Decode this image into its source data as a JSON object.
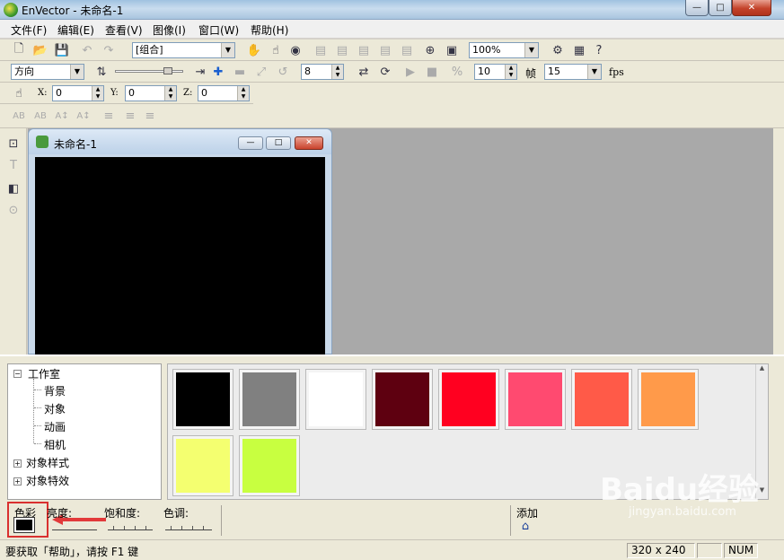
{
  "window": {
    "title": "EnVector - 未命名-1",
    "minimize": "—",
    "maximize": "□",
    "close": "✕"
  },
  "menu": [
    "文件(F)",
    "编辑(E)",
    "查看(V)",
    "图像(I)",
    "窗口(W)",
    "帮助(H)"
  ],
  "toolbar1": {
    "group_combo": "[组合]",
    "zoom_combo": "100%"
  },
  "toolbar2": {
    "direction_combo": "方向",
    "step_value": "8",
    "frames_value": "10",
    "frame_unit": "帧",
    "fps_value": "15",
    "fps_label": "fps"
  },
  "toolbar3": {
    "x_label": "X:",
    "x_value": "0",
    "y_label": "Y:",
    "y_value": "0",
    "z_label": "Z:",
    "z_value": "0"
  },
  "document": {
    "title": "未命名-1"
  },
  "tree": {
    "root": "工作室",
    "children": [
      "背景",
      "对象",
      "动画",
      "相机"
    ],
    "siblings": [
      "对象样式",
      "对象特效"
    ]
  },
  "swatches": [
    "#000000",
    "#808080",
    "#ffffff",
    "#5e0010",
    "#ff0020",
    "#ff4a70",
    "#ff5a48",
    "#ff9a4a",
    "#f4ff70",
    "#c8ff40"
  ],
  "color_controls": {
    "color_label": "色彩",
    "brightness_label": "亮度:",
    "saturation_label": "饱和度:",
    "hue_label": "色调:",
    "add_label": "添加",
    "current_color": "#000000"
  },
  "status": {
    "help_text": "要获取「帮助」，请按 F1 键",
    "size": "320 x 240",
    "num": "NUM"
  },
  "watermark": {
    "main": "Baidu经验",
    "sub": "jingyan.baidu.com"
  }
}
